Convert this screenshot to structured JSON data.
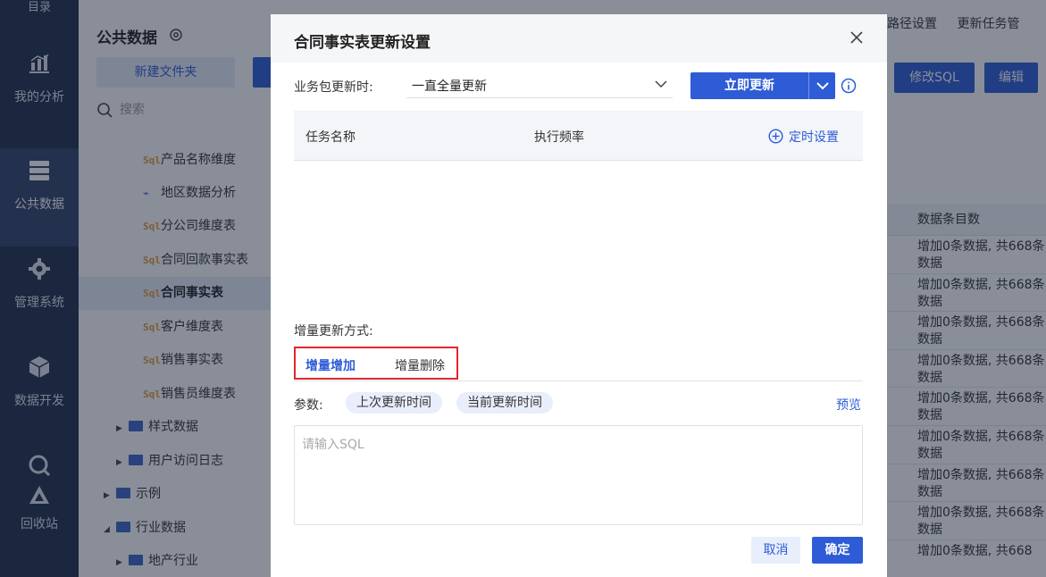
{
  "nav": {
    "top_label": "目录",
    "items": [
      {
        "label": "我的分析",
        "icon": "bar-chart-icon"
      },
      {
        "label": "公共数据",
        "icon": "database-icon",
        "active": true
      },
      {
        "label": "管理系统",
        "icon": "gear-icon"
      },
      {
        "label": "数据开发",
        "icon": "cube-icon"
      },
      {
        "label": "回收站",
        "icon": "recycle-icon"
      }
    ]
  },
  "sidebar": {
    "title": "公共数据",
    "new_folder_label": "新建文件夹",
    "search_placeholder": "搜索",
    "tree": [
      {
        "label": "产品名称维度",
        "icon": "sql-icon"
      },
      {
        "label": "地区数据分析",
        "icon": "analysis-icon"
      },
      {
        "label": "分公司维度表",
        "icon": "sql-icon"
      },
      {
        "label": "合同回款事实表",
        "icon": "sql-icon"
      },
      {
        "label": "合同事实表",
        "icon": "sql-icon",
        "selected": true
      },
      {
        "label": "客户维度表",
        "icon": "sql-icon"
      },
      {
        "label": "销售事实表",
        "icon": "sql-icon"
      },
      {
        "label": "销售员维度表",
        "icon": "sql-icon"
      },
      {
        "label": "样式数据",
        "icon": "folder-icon"
      },
      {
        "label": "用户访问日志",
        "icon": "folder-icon"
      },
      {
        "label": "示例",
        "icon": "folder-icon"
      },
      {
        "label": "行业数据",
        "icon": "folder-icon",
        "expanded": true
      },
      {
        "label": "地产行业",
        "icon": "folder-icon"
      }
    ]
  },
  "main": {
    "toolbar": {
      "path_settings": "路径设置",
      "update_tasks": "更新任务管"
    },
    "modify_sql_label": "修改SQL",
    "edit_label": "编辑",
    "table": {
      "header": "数据条目数",
      "rows": [
        "增加0条数据, 共668条数据",
        "增加0条数据, 共668条数据",
        "增加0条数据, 共668条数据",
        "增加0条数据, 共668条数据",
        "增加0条数据, 共668条数据",
        "增加0条数据, 共668条数据",
        "增加0条数据, 共668条数据",
        "增加0条数据, 共668条数据",
        "增加0条数据, 共668"
      ]
    }
  },
  "dialog": {
    "title": "合同事实表更新设置",
    "package_update_label": "业务包更新时:",
    "update_mode_value": "一直全量更新",
    "update_now_label": "立即更新",
    "task_table": {
      "col_name": "任务名称",
      "col_freq": "执行频率",
      "schedule_label": "定时设置"
    },
    "incremental_label": "增量更新方式:",
    "tabs": [
      {
        "label": "增量增加",
        "active": true
      },
      {
        "label": "增量删除"
      }
    ],
    "params_label": "参数:",
    "param_chips": [
      "上次更新时间",
      "当前更新时间"
    ],
    "preview_label": "预览",
    "sql_placeholder": "请输入SQL",
    "cancel_label": "取消",
    "ok_label": "确定"
  },
  "colors": {
    "accent": "#2e5cd6",
    "nav_bg": "#222f4d",
    "highlight_border": "#e0272c"
  }
}
